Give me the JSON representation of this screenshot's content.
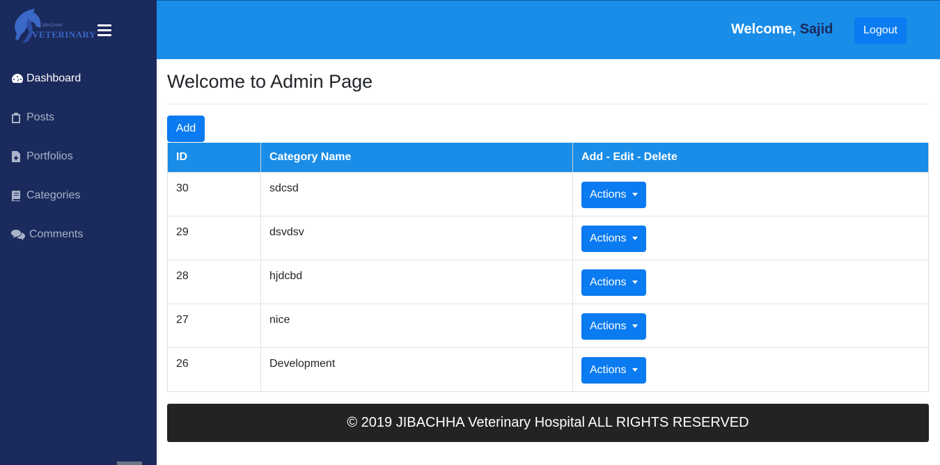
{
  "sidebar": {
    "logo_text": "VETERINARY",
    "logo_small": "JIBACHHA",
    "items": [
      {
        "label": "Dashboard",
        "icon": "tachometer-icon"
      },
      {
        "label": "Posts",
        "icon": "clipboard-icon"
      },
      {
        "label": "Portfolios",
        "icon": "file-plus-icon"
      },
      {
        "label": "Categories",
        "icon": "book-icon"
      },
      {
        "label": "Comments",
        "icon": "comments-icon"
      }
    ]
  },
  "header": {
    "welcome_label": "Welcome,",
    "username": "Sajid",
    "logout_label": "Logout"
  },
  "main": {
    "title": "Welcome to Admin Page",
    "add_label": "Add",
    "table": {
      "columns": [
        "ID",
        "Category Name",
        "Add - Edit - Delete"
      ],
      "rows": [
        {
          "id": "30",
          "name": "sdcsd",
          "action": "Actions"
        },
        {
          "id": "29",
          "name": "dsvdsv",
          "action": "Actions"
        },
        {
          "id": "28",
          "name": "hjdcbd",
          "action": "Actions"
        },
        {
          "id": "27",
          "name": "nice",
          "action": "Actions"
        },
        {
          "id": "26",
          "name": "Development",
          "action": "Actions"
        }
      ]
    }
  },
  "footer": {
    "text": "© 2019 JIBACHHA Veterinary Hospital ALL RIGHTS RESERVED"
  },
  "colors": {
    "sidebar_bg": "#1b2a5c",
    "topbar_bg": "#1a8de8",
    "button_primary": "#0a7bf0",
    "footer_bg": "#232323"
  }
}
